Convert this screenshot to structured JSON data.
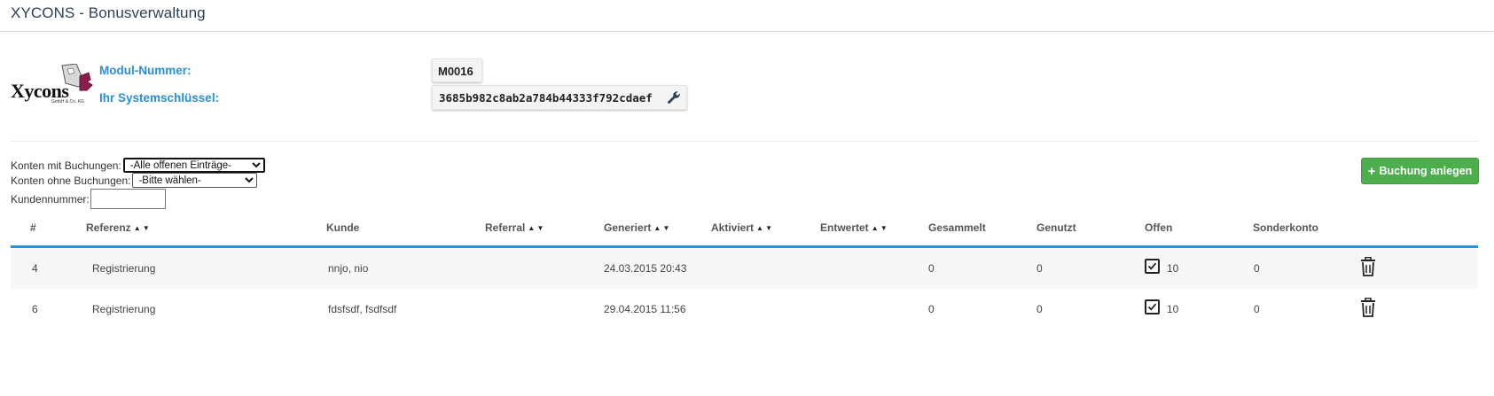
{
  "app": {
    "title": "XYCONS - Bonusverwaltung"
  },
  "logo": {
    "text": "Xycons",
    "sub": "GmbH & Co. KG"
  },
  "info": {
    "modul_label": "Modul-Nummer:",
    "modul_value": "M0016",
    "key_label": "Ihr Systemschlüssel:",
    "key_value": "3685b982c8ab2a784b44333f792cdaef"
  },
  "filters": {
    "mit_label": "Konten mit Buchungen:",
    "mit_selected": "-Alle offenen Einträge-",
    "ohne_label": "Konten ohne Buchungen:",
    "ohne_selected": "-Bitte wählen-",
    "kunden_label": "Kundennummer:",
    "kunden_value": ""
  },
  "actions": {
    "add_label": "Buchung anlegen"
  },
  "colors": {
    "accent": "#2a8fd6",
    "button_green": "#4cae4c",
    "title": "#2f4154"
  },
  "table": {
    "headers": [
      "#",
      "Referenz",
      "Kunde",
      "Referral",
      "Generiert",
      "Aktiviert",
      "Entwertet",
      "Gesammelt",
      "Genutzt",
      "Offen",
      "Sonderkonto"
    ],
    "rows": [
      {
        "id": "4",
        "referenz": "Registrierung",
        "kunde": "nnjo, nio",
        "referral": "",
        "generiert": "24.03.2015 20:43",
        "aktiviert": "",
        "entwertet": "",
        "gesammelt": "0",
        "genutzt": "0",
        "offen_checked": true,
        "offen": "10",
        "sonderkonto": "0"
      },
      {
        "id": "6",
        "referenz": "Registrierung",
        "kunde": "fdsfsdf, fsdfsdf",
        "referral": "",
        "generiert": "29.04.2015 11:56",
        "aktiviert": "",
        "entwertet": "",
        "gesammelt": "0",
        "genutzt": "0",
        "offen_checked": true,
        "offen": "10",
        "sonderkonto": "0"
      }
    ]
  }
}
